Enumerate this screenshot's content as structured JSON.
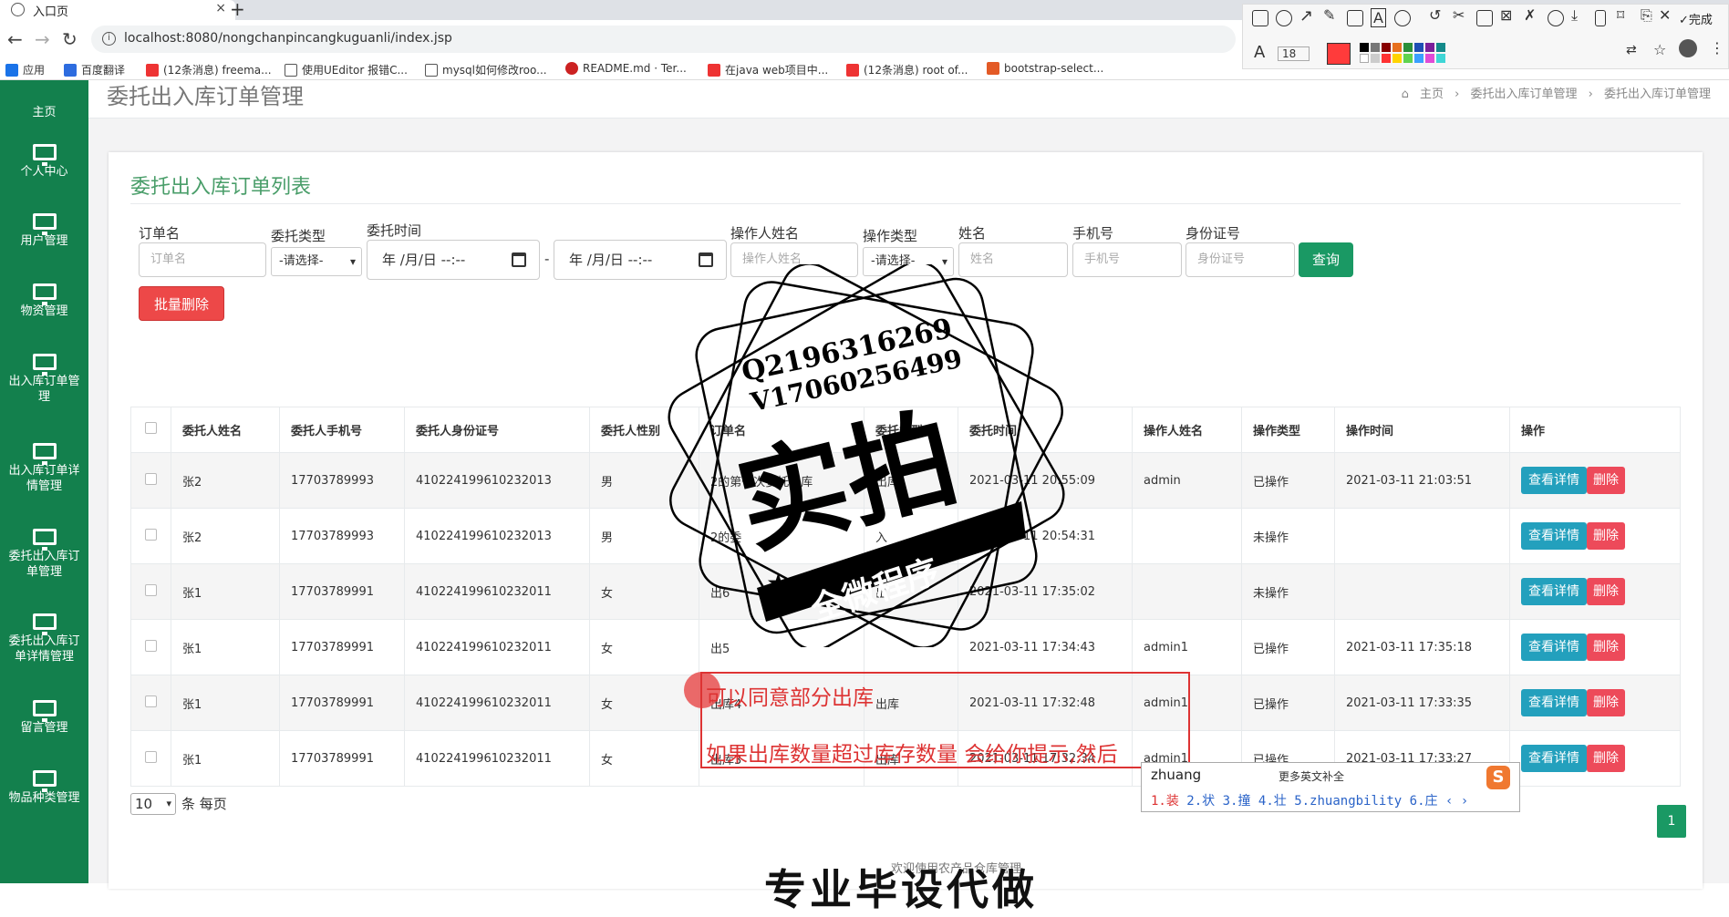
{
  "browser": {
    "tab_title": "入口页",
    "tab_close": "×",
    "new_tab": "+",
    "url": "localhost:8080/nongchanpincangkuguanli/index.jsp",
    "bookmarks": [
      {
        "label": "应用",
        "color": "#1a73e8"
      },
      {
        "label": "百度翻译",
        "color": "#2d6cdf"
      },
      {
        "label": "(12条消息) freema...",
        "color": "#e33"
      },
      {
        "label": "使用UEditor 报错C...",
        "color": "#555"
      },
      {
        "label": "mysql如何修改roo...",
        "color": "#555"
      },
      {
        "label": "README.md · Ter...",
        "color": "#c22"
      },
      {
        "label": "在java web项目中...",
        "color": "#e33"
      },
      {
        "label": "(12条消息) root of...",
        "color": "#e33"
      },
      {
        "label": "bootstrap-select...",
        "color": "#e35a26"
      }
    ]
  },
  "annotation_tool": {
    "font_size": "18",
    "done_label": "完成",
    "current_color": "#ff3b3b"
  },
  "sidebar": {
    "items": [
      {
        "label": "主页"
      },
      {
        "label": "个人中心"
      },
      {
        "label": "用户管理"
      },
      {
        "label": "物资管理"
      },
      {
        "label": "出入库订单管理"
      },
      {
        "label": "出入库订单详情管理"
      },
      {
        "label": "委托出入库订单管理"
      },
      {
        "label": "委托出入库订单详情管理"
      },
      {
        "label": "留言管理"
      },
      {
        "label": "物品种类管理"
      }
    ]
  },
  "header": {
    "title": "委托出入库订单管理",
    "breadcrumb": [
      "主页",
      "委托出入库订单管理",
      "委托出入库订单管理"
    ]
  },
  "card": {
    "title": "委托出入库订单列表"
  },
  "filters": {
    "order_name": {
      "label": "订单名",
      "placeholder": "订单名"
    },
    "entrust_type": {
      "label": "委托类型",
      "value": "-请选择-"
    },
    "entrust_time": {
      "label": "委托时间",
      "start": "年 /月/日 --:--",
      "sep": "-",
      "end": "年 /月/日 --:--"
    },
    "operator_name": {
      "label": "操作人姓名",
      "placeholder": "操作人姓名"
    },
    "op_type": {
      "label": "操作类型",
      "value": "-请选择-"
    },
    "name": {
      "label": "姓名",
      "placeholder": "姓名"
    },
    "phone": {
      "label": "手机号",
      "placeholder": "手机号"
    },
    "id_card": {
      "label": "身份证号",
      "placeholder": "身份证号"
    },
    "query_button": "查询",
    "batch_delete_button": "批量删除"
  },
  "table": {
    "columns": [
      "委托人姓名",
      "委托人手机号",
      "委托人身份证号",
      "委托人性别",
      "订单名",
      "委托类型",
      "委托时间",
      "操作人姓名",
      "操作类型",
      "操作时间",
      "操作"
    ],
    "detail_label": "查看详情",
    "delete_label": "删除",
    "rows": [
      [
        "张2",
        "17703789993",
        "410224199610232013",
        "男",
        "2的第一次委托出库",
        "出库",
        "2021-03-11 20:55:09",
        "admin",
        "已操作",
        "2021-03-11 21:03:51"
      ],
      [
        "张2",
        "17703789993",
        "410224199610232013",
        "男",
        "2的委",
        "入",
        "2021-03-11 20:54:31",
        "",
        "未操作",
        ""
      ],
      [
        "张1",
        "17703789991",
        "410224199610232011",
        "女",
        "出6",
        "出",
        "2021-03-11 17:35:02",
        "",
        "未操作",
        ""
      ],
      [
        "张1",
        "17703789991",
        "410224199610232011",
        "女",
        "出5",
        "",
        "2021-03-11 17:34:43",
        "admin1",
        "已操作",
        "2021-03-11 17:35:18"
      ],
      [
        "张1",
        "17703789991",
        "410224199610232011",
        "女",
        "出库4",
        "出库",
        "2021-03-11 17:32:48",
        "admin1",
        "已操作",
        "2021-03-11 17:33:35"
      ],
      [
        "张1",
        "17703789991",
        "410224199610232011",
        "女",
        "出库3",
        "出库",
        "2021-03-11 17:32:34",
        "admin1",
        "已操作",
        "2021-03-11 17:33:27"
      ]
    ]
  },
  "pager": {
    "page_size": "10",
    "page_size_suffix": "条 每页",
    "current_page": "1"
  },
  "footer": {
    "text": "欢迎使用农产品仓库管理",
    "big_text": "专业毕设代做"
  },
  "stamp": {
    "line1": "Q2196316269",
    "line2": "V17060256499",
    "main": "实拍",
    "ribbon": "全微程序"
  },
  "annotation": {
    "note1": "可以同意部分出库",
    "note2": "如果出库数量超过库存数量  会给你提示,然后"
  },
  "ime": {
    "composition": "zhuang",
    "more_label": "更多英文补全",
    "candidates": [
      "1.装",
      "2.状",
      "3.撞",
      "4.壮",
      "5.zhuangbility",
      "6.庄"
    ],
    "nav": "‹ ›",
    "logo": "S"
  }
}
